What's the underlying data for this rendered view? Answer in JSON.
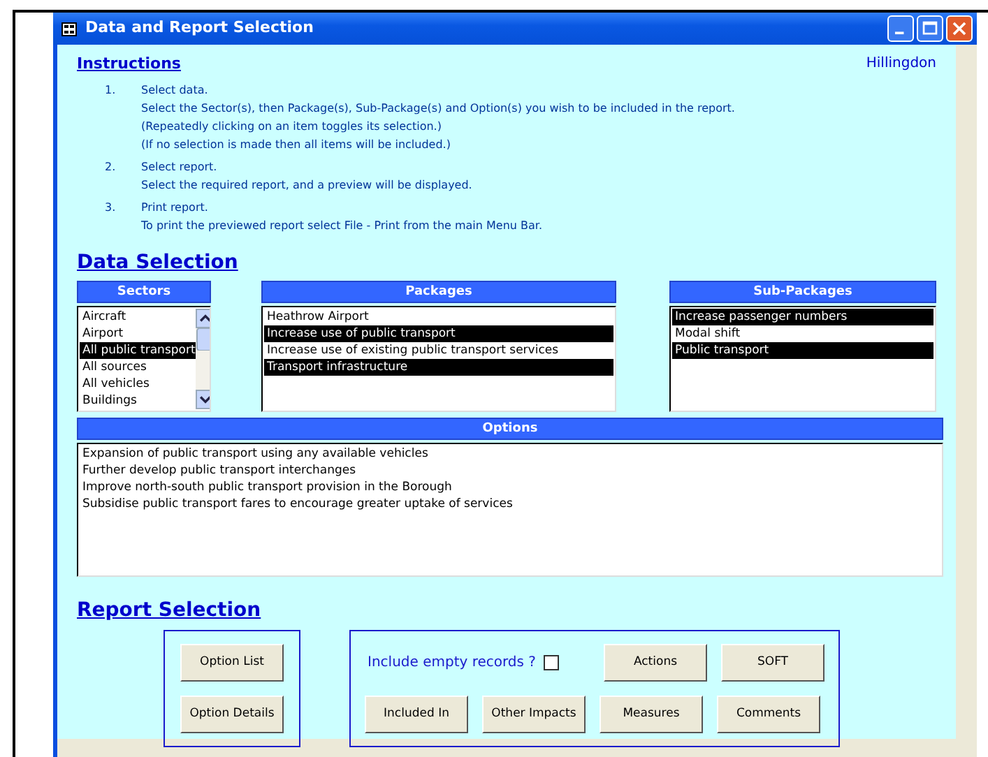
{
  "window": {
    "title": "Data and Report Selection"
  },
  "instructions": {
    "heading": "Instructions",
    "user": "Hillingdon",
    "steps": [
      {
        "number": "1.",
        "lines": [
          "Select data.",
          "Select the Sector(s), then Package(s), Sub-Package(s) and Option(s) you wish to be included in the report.",
          "(Repeatedly clicking on an item toggles its selection.)",
          "(If no selection is made then all items will be included.)"
        ]
      },
      {
        "number": "2.",
        "lines": [
          "Select report.",
          "Select the required report, and a preview will be displayed."
        ]
      },
      {
        "number": "3.",
        "lines": [
          "Print report.",
          "To print the previewed report select File - Print from the main Menu Bar."
        ]
      }
    ]
  },
  "data_selection": {
    "heading": "Data Selection",
    "sectors": {
      "header": "Sectors",
      "items": [
        {
          "label": "Aircraft",
          "selected": false
        },
        {
          "label": "Airport",
          "selected": false
        },
        {
          "label": "All public transport",
          "selected": true
        },
        {
          "label": "All sources",
          "selected": false
        },
        {
          "label": "All vehicles",
          "selected": false
        },
        {
          "label": "Buildings",
          "selected": false
        }
      ]
    },
    "packages": {
      "header": "Packages",
      "items": [
        {
          "label": "Heathrow Airport",
          "selected": false
        },
        {
          "label": "Increase use of  public transport",
          "selected": true
        },
        {
          "label": "Increase use of existing public transport services",
          "selected": false
        },
        {
          "label": "Transport infrastructure",
          "selected": true
        }
      ]
    },
    "sub_packages": {
      "header": "Sub-Packages",
      "items": [
        {
          "label": "Increase passenger numbers",
          "selected": true
        },
        {
          "label": "Modal shift",
          "selected": false
        },
        {
          "label": "Public transport",
          "selected": true
        }
      ]
    },
    "options": {
      "header": "Options",
      "items": [
        {
          "label": "Expansion of public transport using any available vehicles",
          "selected": false
        },
        {
          "label": "Further develop public transport interchanges",
          "selected": false
        },
        {
          "label": "Improve north-south public transport provision in the Borough",
          "selected": false
        },
        {
          "label": "Subsidise public transport fares to encourage greater uptake of services",
          "selected": false
        }
      ]
    }
  },
  "report_selection": {
    "heading": "Report Selection",
    "left_buttons": [
      "Option List",
      "Option Details"
    ],
    "include_empty": {
      "label": "Include empty records ?",
      "checked": false
    },
    "top_buttons": [
      "Actions",
      "SOFT"
    ],
    "bottom_buttons": [
      "Included In",
      "Other Impacts",
      "Measures",
      "Comments"
    ]
  }
}
